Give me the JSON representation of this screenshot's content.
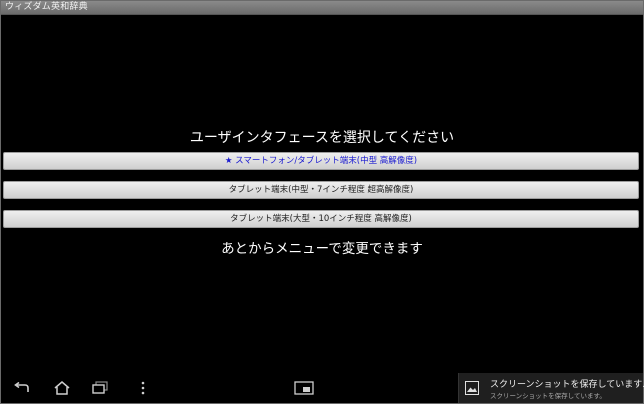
{
  "app": {
    "title": "ウィズダム英和辞典"
  },
  "setup": {
    "prompt": "ユーザインタフェースを選択してください",
    "options": [
      {
        "label": "★ スマートフォン/タブレット端末(中型 高解像度)",
        "selected": true
      },
      {
        "label": "タブレット端末(中型・7インチ程度 超高解像度)",
        "selected": false
      },
      {
        "label": "タブレット端末(大型・10インチ程度 高解像度)",
        "selected": false
      }
    ],
    "note": "あとからメニューで変更できます"
  },
  "navbar": {
    "icons": [
      "back-icon",
      "home-icon",
      "recent-apps-icon",
      "menu-icon",
      "screenshot-icon"
    ]
  },
  "notification": {
    "title": "スクリーンショットを保存しています...",
    "subtitle": "スクリーンショットを保存しています。",
    "icon": "image-icon"
  }
}
